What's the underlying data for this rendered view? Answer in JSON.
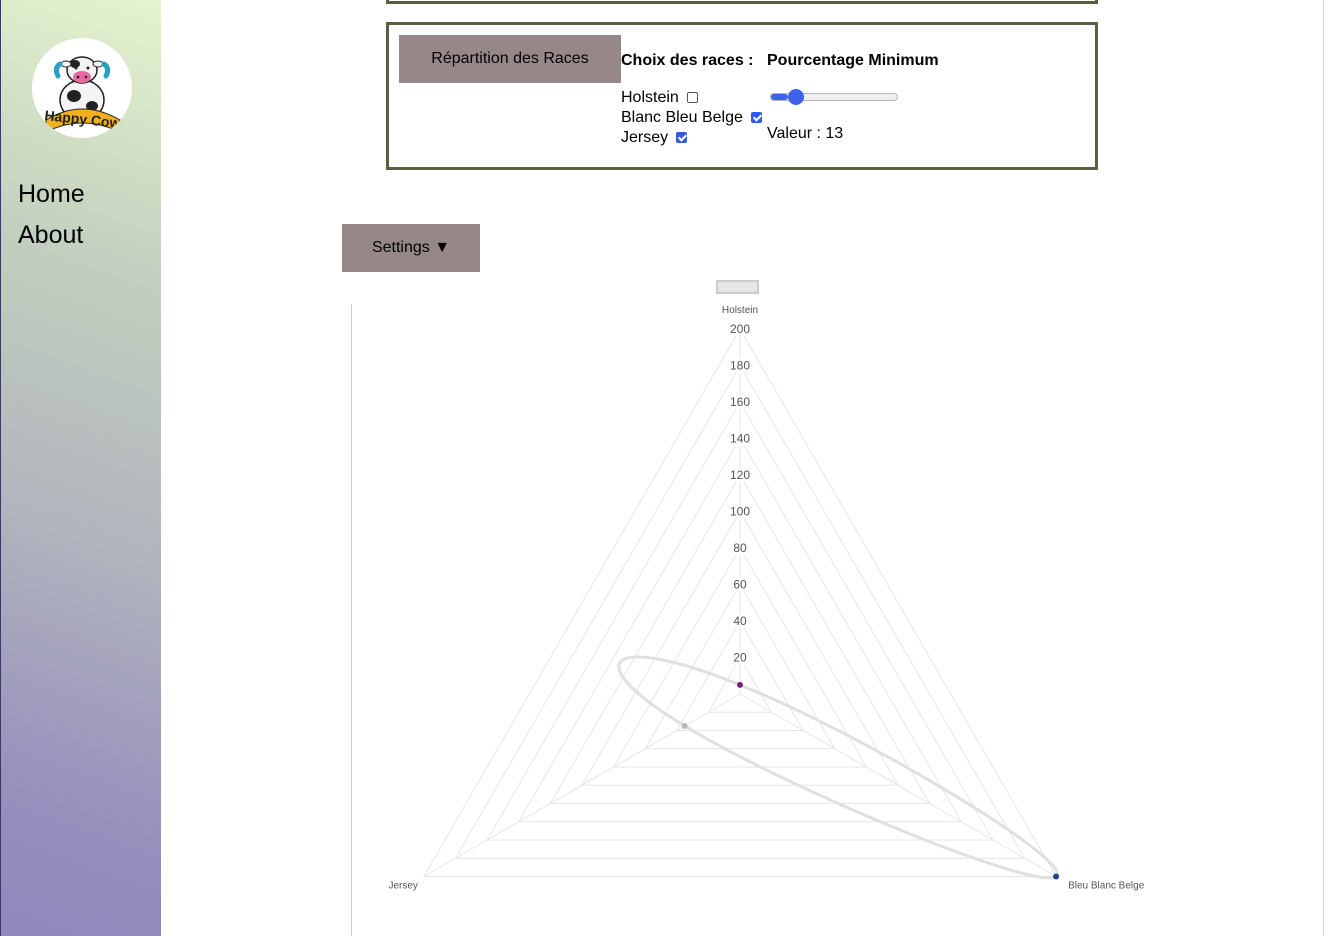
{
  "sidebar": {
    "logo_text": "Happy Cow",
    "nav": [
      {
        "label": "Home"
      },
      {
        "label": "About"
      }
    ]
  },
  "panel": {
    "title": "Répartition des Races",
    "choice_heading": "Choix des races :",
    "pct_heading": "Pourcentage Minimum",
    "breeds": [
      {
        "label": "Holstein",
        "checked": false
      },
      {
        "label": "Blanc Bleu Belge",
        "checked": true
      },
      {
        "label": "Jersey",
        "checked": true
      }
    ],
    "slider": {
      "min": 0,
      "max": 100,
      "value": 13
    },
    "value_label": "Valeur : 13"
  },
  "settings_label": "Settings ▼",
  "colors": {
    "button_bg": "#968888",
    "panel_border": "#5a5f44",
    "accent": "#3d62e8",
    "point_holstein": "#7a1f7a",
    "point_bleu_blanc_belge": "#233f8f",
    "point_jersey": "#b8b8b8"
  },
  "chart_data": {
    "type": "radar",
    "axes": [
      "Holstein",
      "Bleu Blanc Belge",
      "Jersey"
    ],
    "r_ticks": [
      20,
      40,
      60,
      80,
      100,
      120,
      140,
      160,
      180,
      200
    ],
    "rlim": [
      0,
      200
    ],
    "legend": "top, single empty swatch",
    "series": [
      {
        "values": [
          5,
          200,
          35
        ],
        "curved": true
      }
    ]
  }
}
